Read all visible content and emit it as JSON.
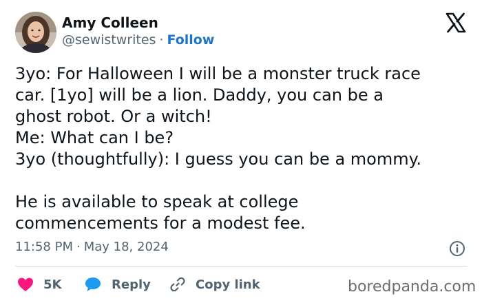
{
  "author": {
    "name": "Amy Colleen",
    "handle": "@sewistwrites",
    "separator": "·",
    "follow_label": "Follow"
  },
  "tweet": {
    "lines": [
      "3yo: For Halloween I will be a monster truck race",
      "car. [1yo] will be a lion.  Daddy, you can be a",
      "ghost robot. Or a witch!",
      "Me: What can I be?",
      "3yo (thoughtfully): I guess you can be a mommy.",
      "He is available to speak at college",
      "commencements for a modest fee."
    ]
  },
  "meta": {
    "time": "11:58 PM",
    "separator": "·",
    "date": "May 18, 2024"
  },
  "actions": {
    "like_count": "5K",
    "reply_label": "Reply",
    "copy_link_label": "Copy link"
  },
  "icons": {
    "platform": "x-logo-icon",
    "info": "info-icon",
    "like": "heart-icon",
    "reply": "speech-bubble-icon",
    "copy": "link-icon"
  },
  "colors": {
    "heart": "#f91880",
    "reply": "#1d9bf0",
    "follow": "#1d74c9",
    "muted": "#536471"
  },
  "watermark": "boredpanda.com"
}
